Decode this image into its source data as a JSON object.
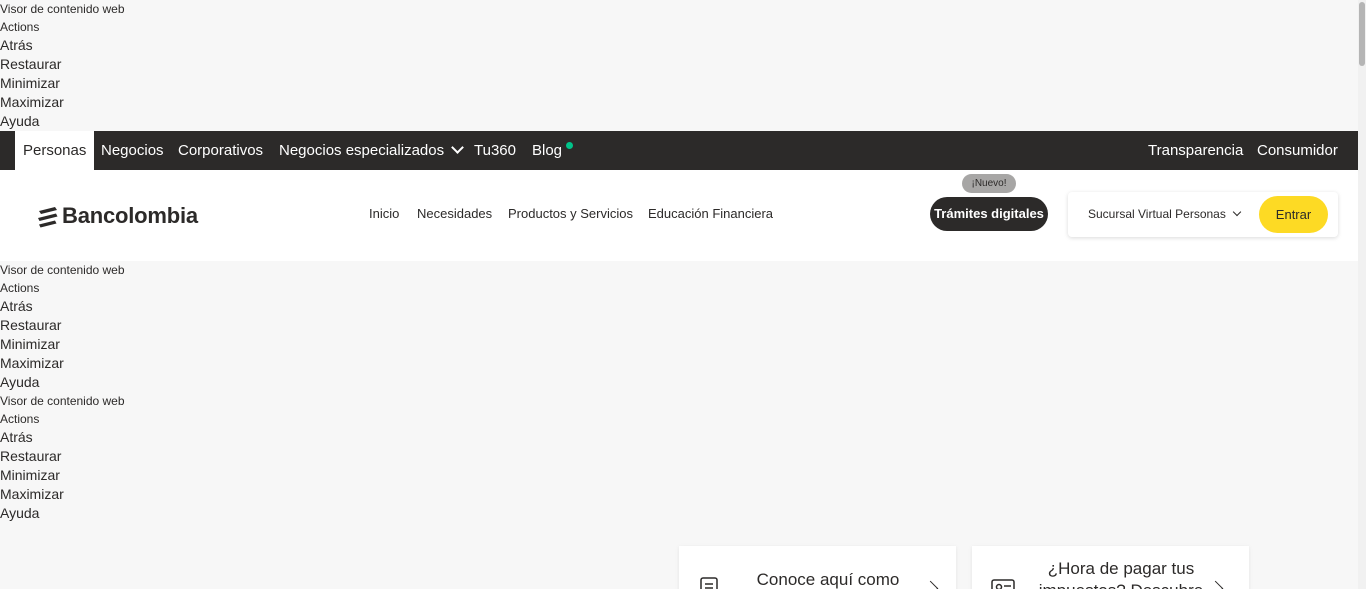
{
  "portlet_blocks": [
    {
      "title": "Visor de contenido web",
      "actions": "Actions",
      "items": [
        "Atrás",
        "Restaurar",
        "Minimizar",
        "Maximizar",
        "Ayuda"
      ]
    },
    {
      "title": "Visor de contenido web",
      "actions": "Actions",
      "items": [
        "Atrás",
        "Restaurar",
        "Minimizar",
        "Maximizar",
        "Ayuda"
      ]
    },
    {
      "title": "Visor de contenido web",
      "actions": "Actions",
      "items": [
        "Atrás",
        "Restaurar",
        "Minimizar",
        "Maximizar",
        "Ayuda"
      ]
    }
  ],
  "topbar": {
    "tabs": [
      "Personas",
      "Negocios",
      "Corporativos",
      "Negocios especializados",
      "Tu360",
      "Blog"
    ],
    "active_tab": "Personas",
    "right_links": [
      "Transparencia",
      "Consumidor"
    ],
    "blog_dot_color": "#00c389"
  },
  "header": {
    "logo_text": "Bancolombia",
    "nav": [
      "Inicio",
      "Necesidades",
      "Productos y Servicios",
      "Educación Financiera"
    ],
    "badge": "¡Nuevo!",
    "tramites_button": "Trámites digitales",
    "login_select": "Sucursal Virtual Personas",
    "enter_button": "Entrar"
  },
  "cards": [
    {
      "text": "Conoce aquí como",
      "icon": "document-icon"
    },
    {
      "text": "¿Hora de pagar tus impuestos? Descubre",
      "icon": "id-card-icon"
    }
  ],
  "colors": {
    "topbar_bg": "#2c2a29",
    "accent_yellow": "#fdda24",
    "page_bg": "#f7f7f7"
  }
}
